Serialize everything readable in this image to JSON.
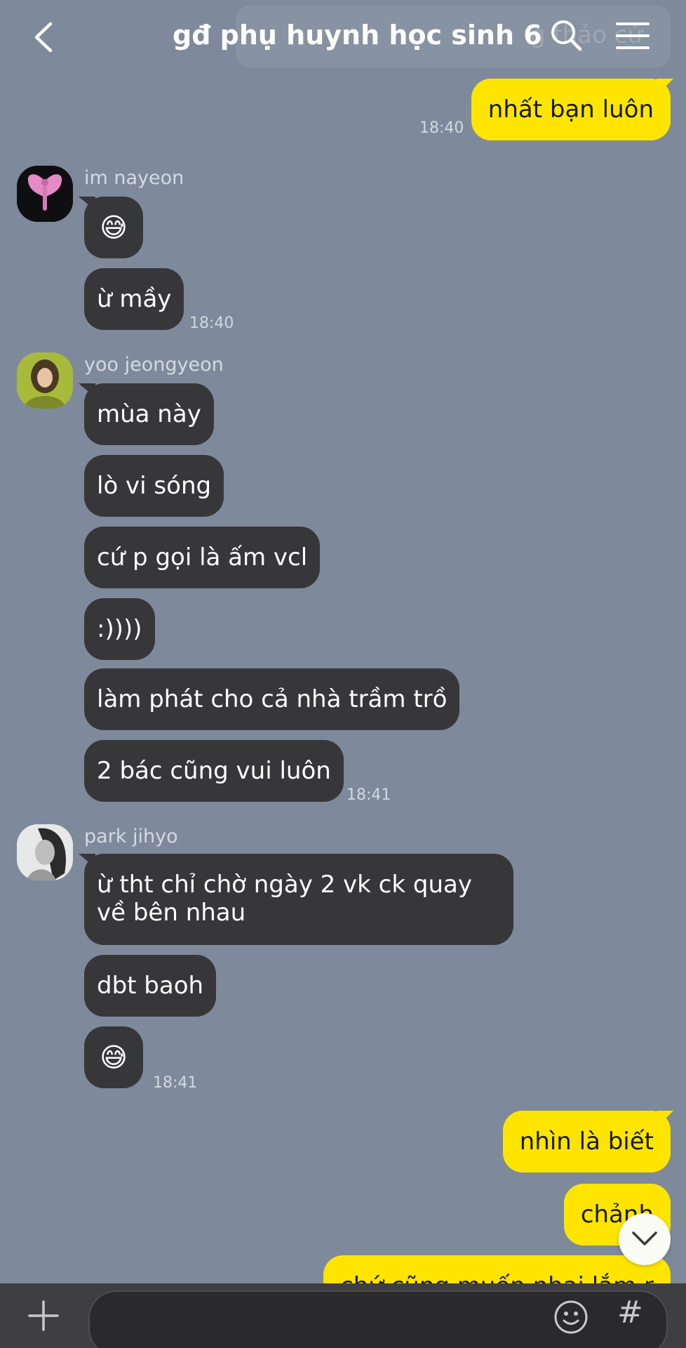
{
  "header": {
    "title": "gđ phụ huynh học sinh 6",
    "notice_preview": "g thảo cứ"
  },
  "messages": {
    "m1": {
      "text": "nhất bạn luôn",
      "time": "18:40"
    },
    "nayeon": {
      "sender": "im nayeon",
      "b1": "😅",
      "b2": "ừ mầy",
      "time": "18:40"
    },
    "jeongyeon": {
      "sender": "yoo jeongyeon",
      "b1": "mùa này",
      "b2": "lò vi sóng",
      "b3": "cứ p gọi là ấm vcl",
      "b4": ":))))",
      "b5": "làm phát cho cả nhà trầm trồ",
      "b6": "2 bác cũng vui luôn",
      "time": "18:41"
    },
    "jihyo": {
      "sender": "park jihyo",
      "b1": "ừ tht chỉ chờ ngày 2 vk ck quay về bên nhau",
      "b2": "dbt baoh",
      "b3": "😅",
      "time": "18:41"
    },
    "m_out2": "nhìn là biết",
    "m_out3": "chảnh",
    "m_out4": "chứ cũng muốn nhai lắm r"
  },
  "input": {
    "hash_label": "#"
  },
  "colors": {
    "background": "#7e8a9b",
    "incoming_bubble": "#37373a",
    "outgoing_bubble": "#fee500",
    "input_bar": "#3f3f42"
  }
}
